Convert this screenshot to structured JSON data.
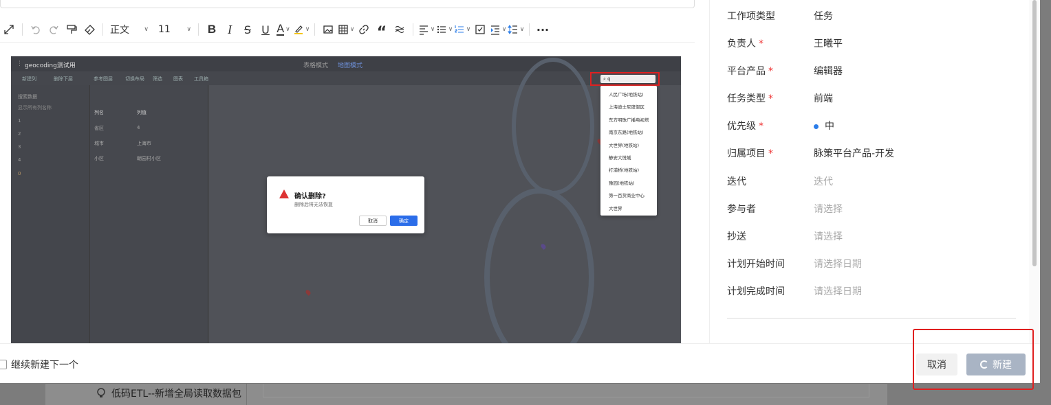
{
  "background": {
    "item_text": "低码ETL--新增全局读取数据包",
    "item_icon": "bulb-icon"
  },
  "toolbar": {
    "paragraph_style": "正文",
    "font_size": "11",
    "icons": [
      "expand-icon",
      "undo-icon",
      "redo-icon",
      "format-painter-icon",
      "eraser-icon",
      "bold-icon",
      "italic-icon",
      "strikethrough-icon",
      "underline-icon",
      "font-color-icon",
      "highlight-icon",
      "image-icon",
      "table-icon",
      "link-icon",
      "quote-icon",
      "divider-icon",
      "align-icon",
      "bullet-list-icon",
      "ordered-list-icon",
      "checkbox-list-icon",
      "indent-icon",
      "line-height-icon",
      "more-icon"
    ],
    "glyphs": {
      "bold": "B",
      "italic": "I",
      "strike": "S",
      "underline": "U",
      "font_color": "A",
      "quote": "“",
      "more": "···"
    }
  },
  "embedded_screenshot": {
    "app_title": "geocoding测试用",
    "view_tabs": [
      "表格模式",
      "地图模式"
    ],
    "tool_items": [
      "新建列",
      "删除下层",
      "参考图层",
      "切换布局",
      "筛选",
      "图表",
      "工具箱"
    ],
    "search_placeholder": "搜索数据",
    "dropdown_hint": "显示所有列名称",
    "tree_items": [
      "1",
      "2",
      "3",
      "4",
      "0"
    ],
    "table_headers": [
      "列名",
      "列值"
    ],
    "table_rows": [
      [
        "省区",
        "4"
      ],
      [
        "城市",
        "上海市"
      ],
      [
        "小区",
        "朝园村小区"
      ]
    ],
    "search_query": "q",
    "search_results": [
      "人民广场(地铁站)",
      "上海迪士尼度假区",
      "东方明珠广播电视塔",
      "南京东路(地铁站)",
      "大世界(地铁站)",
      "静安大悦城",
      "打浦桥(地铁站)",
      "豫园(地铁站)",
      "第一百货商业中心",
      "大世界"
    ],
    "confirm": {
      "title": "确认删除?",
      "subtitle": "删除后将无法恢复",
      "cancel": "取消",
      "ok": "确定"
    }
  },
  "properties": [
    {
      "label": "工作项类型",
      "required": false,
      "value": "任务",
      "placeholder": false
    },
    {
      "label": "负责人",
      "required": true,
      "value": "王曦平",
      "placeholder": false
    },
    {
      "label": "平台产品",
      "required": true,
      "value": "编辑器",
      "placeholder": false
    },
    {
      "label": "任务类型",
      "required": true,
      "value": "前端",
      "placeholder": false
    },
    {
      "label": "优先级",
      "required": true,
      "value": "中",
      "placeholder": false,
      "dot_color": "#2b7de9"
    },
    {
      "label": "归属项目",
      "required": true,
      "value": "脉策平台产品-开发",
      "placeholder": false
    },
    {
      "label": "迭代",
      "required": false,
      "value": "迭代",
      "placeholder": true
    },
    {
      "label": "参与者",
      "required": false,
      "value": "请选择",
      "placeholder": true
    },
    {
      "label": "抄送",
      "required": false,
      "value": "请选择",
      "placeholder": true
    },
    {
      "label": "计划开始时间",
      "required": false,
      "value": "请选择日期",
      "placeholder": true
    },
    {
      "label": "计划完成时间",
      "required": false,
      "value": "请选择日期",
      "placeholder": true
    }
  ],
  "footer": {
    "continue_label": "继续新建下一个",
    "cancel_label": "取消",
    "create_label": "新建"
  },
  "colors": {
    "required_star": "#e33",
    "primary": "#2b7de9",
    "highlight_box": "#e02020"
  }
}
